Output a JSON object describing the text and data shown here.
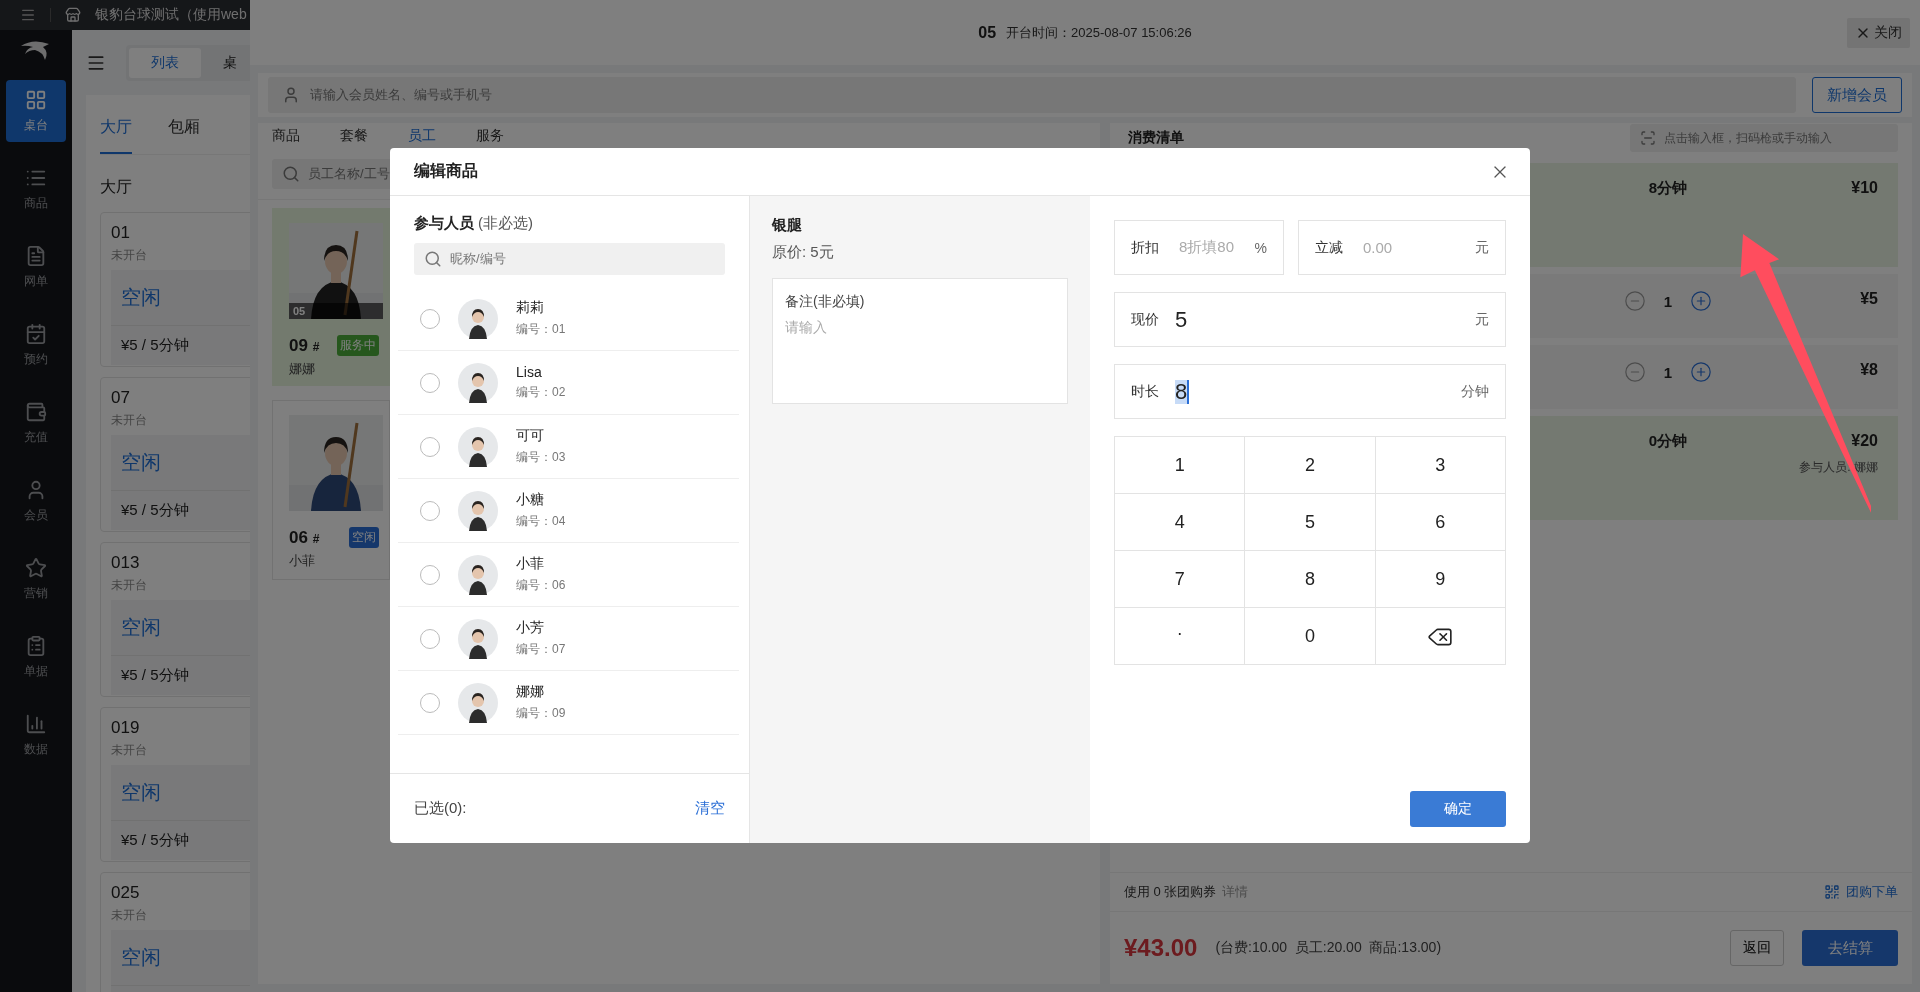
{
  "top_bar": {
    "store_name": "银豹台球测试（使用web"
  },
  "sidebar": {
    "items": [
      {
        "label": "桌台",
        "selected": true
      },
      {
        "label": "商品",
        "selected": false
      },
      {
        "label": "网单",
        "selected": false
      },
      {
        "label": "预约",
        "selected": false
      },
      {
        "label": "充值",
        "selected": false
      },
      {
        "label": "会员",
        "selected": false
      },
      {
        "label": "营销",
        "selected": false
      },
      {
        "label": "单据",
        "selected": false
      },
      {
        "label": "数据",
        "selected": false
      }
    ]
  },
  "main": {
    "view_tabs": [
      {
        "label": "列表",
        "selected": true
      },
      {
        "label": "桌",
        "selected": false
      }
    ],
    "area_tabs": [
      {
        "label": "大厅",
        "selected": true
      },
      {
        "label": "包厢",
        "selected": false
      }
    ],
    "area_title": "大厅",
    "tables": [
      {
        "number": "01",
        "state": "未开台",
        "status": "空闲",
        "price": "¥5 / 5分钟"
      },
      {
        "number": "07",
        "state": "未开台",
        "status": "空闲",
        "price": "¥5 / 5分钟"
      },
      {
        "number": "013",
        "state": "未开台",
        "status": "空闲",
        "price": "¥5 / 5分钟"
      },
      {
        "number": "019",
        "state": "未开台",
        "status": "空闲",
        "price": "¥5 / 5分钟"
      },
      {
        "number": "025",
        "state": "未开台",
        "status": "空闲"
      }
    ]
  },
  "drawer": {
    "table_number": "05",
    "open_time": "开台时间：2025-08-07 15:06:26",
    "close_button": "关闭",
    "member_search": {
      "placeholder": "请输入会员姓名、编号或手机号"
    },
    "add_member_button": "新增会员",
    "tabs": [
      {
        "label": "商品",
        "selected": false
      },
      {
        "label": "套餐",
        "selected": false
      },
      {
        "label": "员工",
        "selected": true
      },
      {
        "label": "服务",
        "selected": false
      }
    ],
    "staff_search": {
      "placeholder": "员工名称/工号"
    },
    "staff_cards": [
      {
        "kind": "serving",
        "table": "05",
        "number": "09",
        "suffix": "#",
        "badge": "服务中",
        "name": "娜娜"
      },
      {
        "kind": "idle",
        "number": "06",
        "suffix": "#",
        "badge": "空闲",
        "name": "小菲"
      }
    ],
    "bill": {
      "title": "消费清单",
      "scan_field": {
        "placeholder": "点击输入框，扫码枪或手动输入"
      },
      "items": [
        {
          "kind": "timed",
          "duration": "8分钟",
          "price": "¥10"
        },
        {
          "kind": "counter",
          "quantity": "1",
          "price": "¥5"
        },
        {
          "kind": "counter",
          "quantity": "1",
          "price": "¥8"
        },
        {
          "kind": "timed",
          "duration": "0分钟",
          "price": "¥20",
          "note": "参与人员: 娜娜"
        }
      ],
      "coupon_text": "使用 0 张团购券",
      "coupon_link": "详情",
      "group_order": "团购下单",
      "total": "¥43.00",
      "breakdown": "(台费:10.00  员工:20.00  商品:13.00)",
      "back_button": "返回",
      "checkout_button": "去结算"
    }
  },
  "modal": {
    "title": "编辑商品",
    "participants": {
      "title": "参与人员",
      "hint": "(非必选)",
      "search": {
        "placeholder": "昵称/编号"
      },
      "staff": [
        {
          "name": "莉莉",
          "code": "编号：01",
          "selected": false
        },
        {
          "name": "Lisa",
          "code": "编号：02",
          "selected": false
        },
        {
          "name": "可可",
          "code": "编号：03",
          "selected": false
        },
        {
          "name": "小糖",
          "code": "编号：04",
          "selected": false
        },
        {
          "name": "小菲",
          "code": "编号：06",
          "selected": false
        },
        {
          "name": "小芳",
          "code": "编号：07",
          "selected": false
        },
        {
          "name": "娜娜",
          "code": "编号：09",
          "selected": false
        }
      ],
      "selected_count": "已选(0):",
      "clear": "清空"
    },
    "product": {
      "name": "银腿",
      "original_price": "原价: 5元",
      "note": {
        "label": "备注(非必填)",
        "placeholder": "请输入"
      }
    },
    "pricing": [
      {
        "label": "折扣",
        "placeholder": "8折填80",
        "unit": "%",
        "focused": false
      },
      {
        "label": "立减",
        "placeholder": "0.00",
        "unit": "元",
        "focused": false
      },
      {
        "label": "现价",
        "value": "5",
        "unit": "元",
        "focused": false
      },
      {
        "label": "时长",
        "value": "8",
        "unit": "分钟",
        "focused": true
      }
    ],
    "keypad": [
      {
        "kind": "char",
        "label": "1"
      },
      {
        "kind": "char",
        "label": "2"
      },
      {
        "kind": "char",
        "label": "3"
      },
      {
        "kind": "char",
        "label": "4"
      },
      {
        "kind": "char",
        "label": "5"
      },
      {
        "kind": "char",
        "label": "6"
      },
      {
        "kind": "char",
        "label": "7"
      },
      {
        "kind": "char",
        "label": "8"
      },
      {
        "kind": "char",
        "label": "9"
      },
      {
        "kind": "point",
        "label": "."
      },
      {
        "kind": "char",
        "label": "0"
      },
      {
        "kind": "backspace"
      }
    ],
    "confirm_button": "确定"
  }
}
